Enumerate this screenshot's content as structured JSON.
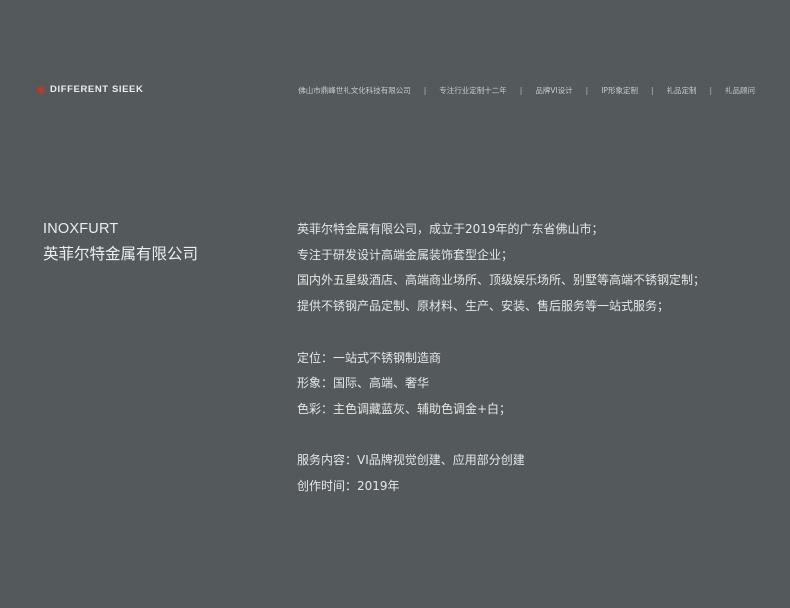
{
  "header": {
    "logo_text": "DIFFERENT SIEEK",
    "logo_icon": "asterisk-burst-icon",
    "accent_color": "#c0392b",
    "nav_items": [
      "佛山市鼎峰世礼文化科技有限公司",
      "专注行业定制十二年",
      "品牌VI设计",
      "IP形象定制",
      "礼品定制",
      "礼品顾问"
    ],
    "nav_separator": "|"
  },
  "brand": {
    "name_en": "INOXFURT",
    "name_cn": "英菲尔特金属有限公司"
  },
  "description": {
    "intro": [
      "英菲尔特金属有限公司，成立于2019年的广东省佛山市；",
      "专注于研发设计高端金属装饰套型企业；",
      "国内外五星级酒店、高端商业场所、顶级娱乐场所、别墅等高端不锈钢定制；",
      "提供不锈钢产品定制、原材料、生产、安装、售后服务等一站式服务；"
    ],
    "positioning": [
      "定位：一站式不锈钢制造商",
      "形象：国际、高端、奢华",
      "色彩：主色调藏蓝灰、辅助色调金+白；"
    ],
    "service": [
      "服务内容：VI品牌视觉创建、应用部分创建",
      "创作时间：2019年"
    ]
  },
  "colors": {
    "background": "#54595b",
    "text": "#e6e7e7"
  }
}
